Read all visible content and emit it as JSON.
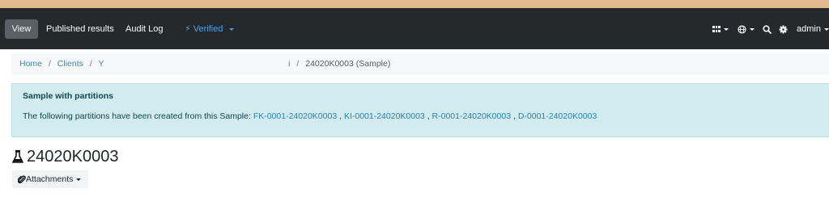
{
  "navbar": {
    "items": [
      {
        "label": "View"
      },
      {
        "label": "Published results"
      },
      {
        "label": "Audit Log"
      },
      {
        "label": "Verified"
      }
    ],
    "right": {
      "apps_icon": "apps-grid-icon",
      "language_icon": "globe-icon",
      "search_icon": "search-icon",
      "settings_icon": "gear-icon",
      "user_label": "admin"
    },
    "colors": {
      "background": "#26292c",
      "active": "#5a6066",
      "verified": "#4aa3e6"
    }
  },
  "breadcrumb": {
    "home": "Home",
    "clients": "Clients",
    "client": "Y",
    "client_tail": "i",
    "separator": "/",
    "current": "24020K0003 (Sample)"
  },
  "alert": {
    "title": "Sample with partitions",
    "text": "The following partitions have been created from this Sample:",
    "partitions": [
      "FK-0001-24020K0003",
      "KI-0001-24020K0003",
      "R-0001-24020K0003",
      "D-0001-24020K0003"
    ],
    "separator": ","
  },
  "sample": {
    "icon": "flask-icon",
    "title": "24020K0003"
  },
  "attachments": {
    "icon": "paperclip-icon",
    "label": "Attachments"
  }
}
